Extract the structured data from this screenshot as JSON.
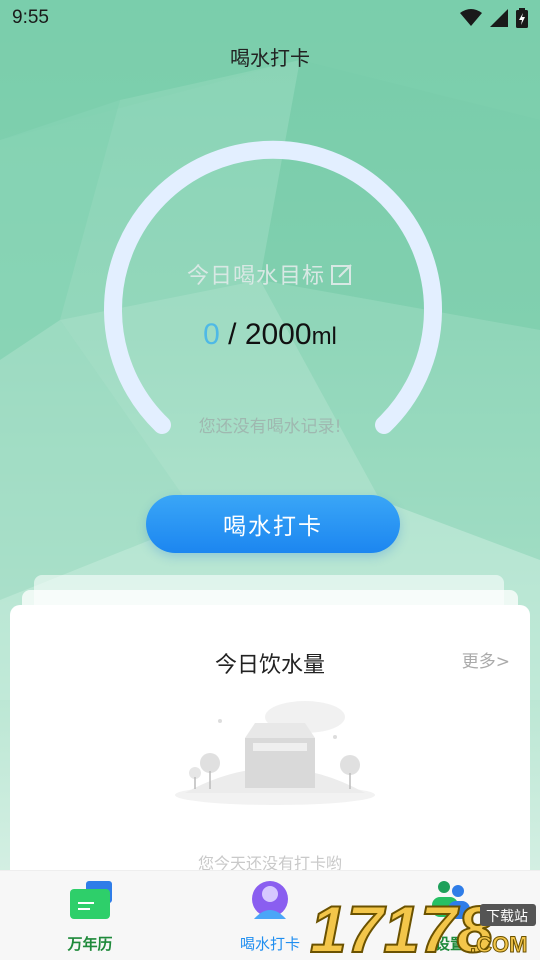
{
  "status_bar": {
    "time": "9:55",
    "icons": [
      "wifi-icon",
      "cell-signal-icon",
      "battery-charging-icon"
    ]
  },
  "header": {
    "title": "喝水打卡"
  },
  "goal": {
    "label": "今日喝水目标",
    "edit_icon": "edit-icon",
    "current": "0",
    "separator": " / ",
    "target": "2000",
    "unit": "ml",
    "progress_percent": 0,
    "empty_message": "您还没有喝水记录!"
  },
  "checkin_button": {
    "label": "喝水打卡"
  },
  "today_card": {
    "title": "今日饮水量",
    "more": "更多>",
    "empty_text": "您今天还没有打卡哟"
  },
  "bottom_nav": {
    "items": [
      {
        "label": "万年历",
        "icon": "calendar-folder-icon",
        "active": false
      },
      {
        "label": "喝水打卡",
        "icon": "user-avatar-icon",
        "active": true
      },
      {
        "label": "设置",
        "icon": "settings-people-icon",
        "active": false
      }
    ]
  },
  "watermark": {
    "number": "17178",
    "tag": "下载站",
    "suffix": ".COM"
  },
  "colors": {
    "accent_blue": "#1f8ef0",
    "nav_green": "#1f8a3b",
    "ring_color": "#e3efff",
    "current_value": "#4fb9e6"
  }
}
